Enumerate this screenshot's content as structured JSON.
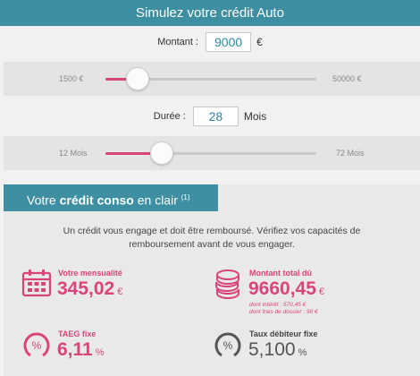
{
  "header": {
    "title": "Simulez votre crédit Auto"
  },
  "amount": {
    "label": "Montant :",
    "value": "9000",
    "unit": "€",
    "min_label": "1500 €",
    "max_label": "50000 €",
    "min": 1500,
    "max": 50000
  },
  "duration": {
    "label": "Durée :",
    "value": "28",
    "unit": "Mois",
    "min_label": "12 Mois",
    "max_label": "72 Mois",
    "min": 12,
    "max": 72
  },
  "panel": {
    "tab_prefix": "Votre ",
    "tab_bold": "crédit conso",
    "tab_suffix": " en clair ",
    "tab_sup": "(1)",
    "notice_line1": "Un crédit vous engage et doit être remboursé. Vérifiez vos capacités de",
    "notice_line2": "remboursement avant de vous engager."
  },
  "metrics": {
    "monthly": {
      "label": "Votre mensualité",
      "value": "345,02",
      "unit": "€",
      "icon": "calendar-icon"
    },
    "total": {
      "label": "Montant total dû",
      "value": "9660,45",
      "unit": "€",
      "icon": "coins-icon",
      "note1": "dont intérêt : 570,45 €",
      "note2": "dont frais de dossier : 90 €"
    },
    "taeg": {
      "label": "TAEG fixe",
      "value": "6,11",
      "unit": "%",
      "icon": "percent-gauge-icon"
    },
    "taux": {
      "label": "Taux débiteur fixe",
      "value": "5,100",
      "unit": "%",
      "icon": "percent-gauge-icon"
    }
  },
  "colors": {
    "accent": "#d9447b",
    "header": "#3d8fa1"
  }
}
